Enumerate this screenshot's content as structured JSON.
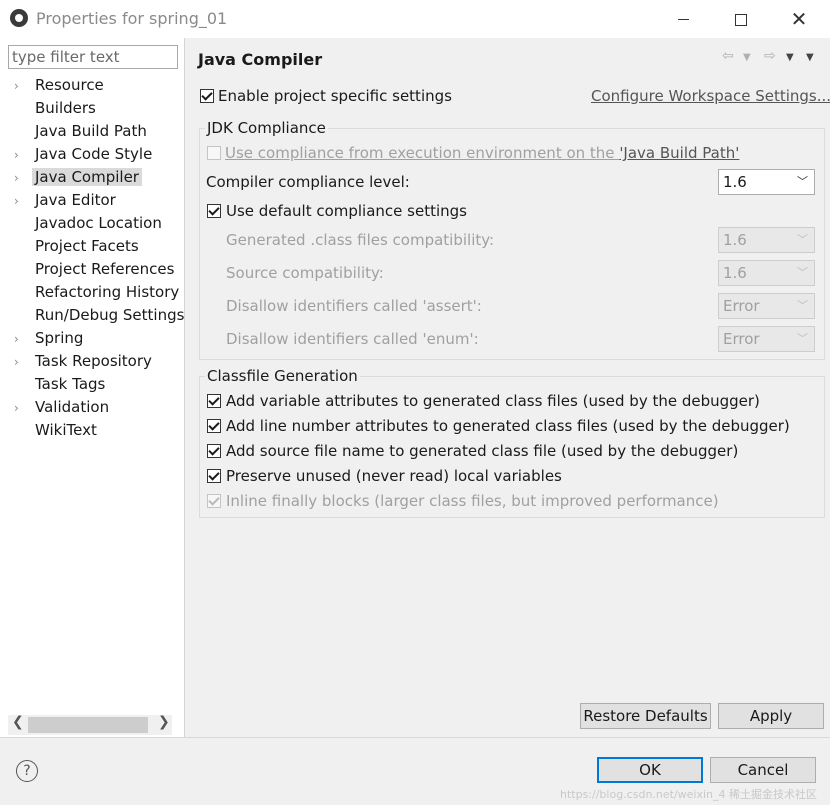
{
  "window": {
    "title": "Properties for spring_01",
    "minimize_label": "",
    "close_glyph": "✕"
  },
  "sidebar": {
    "filter_placeholder": "type filter text",
    "items": [
      {
        "label": "Resource",
        "expandable": true,
        "selected": false
      },
      {
        "label": "Builders",
        "expandable": false,
        "selected": false
      },
      {
        "label": "Java Build Path",
        "expandable": false,
        "selected": false
      },
      {
        "label": "Java Code Style",
        "expandable": true,
        "selected": false
      },
      {
        "label": "Java Compiler",
        "expandable": true,
        "selected": true
      },
      {
        "label": "Java Editor",
        "expandable": true,
        "selected": false
      },
      {
        "label": "Javadoc Location",
        "expandable": false,
        "selected": false
      },
      {
        "label": "Project Facets",
        "expandable": false,
        "selected": false
      },
      {
        "label": "Project References",
        "expandable": false,
        "selected": false
      },
      {
        "label": "Refactoring History",
        "expandable": false,
        "selected": false
      },
      {
        "label": "Run/Debug Settings",
        "expandable": false,
        "selected": false
      },
      {
        "label": "Spring",
        "expandable": true,
        "selected": false
      },
      {
        "label": "Task Repository",
        "expandable": true,
        "selected": false
      },
      {
        "label": "Task Tags",
        "expandable": false,
        "selected": false
      },
      {
        "label": "Validation",
        "expandable": true,
        "selected": false
      },
      {
        "label": "WikiText",
        "expandable": false,
        "selected": false
      }
    ]
  },
  "page": {
    "title": "Java Compiler",
    "enable_project_settings": {
      "label": "Enable project specific settings",
      "checked": true
    },
    "configure_workspace_link": "Configure Workspace Settings...",
    "jdk_compliance": {
      "title": "JDK Compliance",
      "use_env_compliance_prefix": "Use compliance from execution environment on the ",
      "use_env_compliance_link": "'Java Build Path'",
      "compliance_level_label": "Compiler compliance level:",
      "compliance_level_value": "1.6",
      "use_default_label": "Use default compliance settings",
      "generated_class_label": "Generated .class files compatibility:",
      "generated_class_value": "1.6",
      "source_compat_label": "Source compatibility:",
      "source_compat_value": "1.6",
      "assert_label": "Disallow identifiers called 'assert':",
      "assert_value": "Error",
      "enum_label": "Disallow identifiers called 'enum':",
      "enum_value": "Error"
    },
    "classfile": {
      "title": "Classfile Generation",
      "items": [
        {
          "label": "Add variable attributes to generated class files (used by the debugger)",
          "checked": true,
          "disabled": false
        },
        {
          "label": "Add line number attributes to generated class files (used by the debugger)",
          "checked": true,
          "disabled": false
        },
        {
          "label": "Add source file name to generated class file (used by the debugger)",
          "checked": true,
          "disabled": false
        },
        {
          "label": "Preserve unused (never read) local variables",
          "checked": true,
          "disabled": false
        },
        {
          "label": "Inline finally blocks (larger class files, but improved performance)",
          "checked": true,
          "disabled": true
        }
      ]
    },
    "restore_defaults": "Restore Defaults",
    "apply": "Apply"
  },
  "footer": {
    "help_glyph": "?",
    "ok": "OK",
    "cancel": "Cancel",
    "watermark": "https://blog.csdn.net/weixin_4 稀土掘金技术社区"
  }
}
